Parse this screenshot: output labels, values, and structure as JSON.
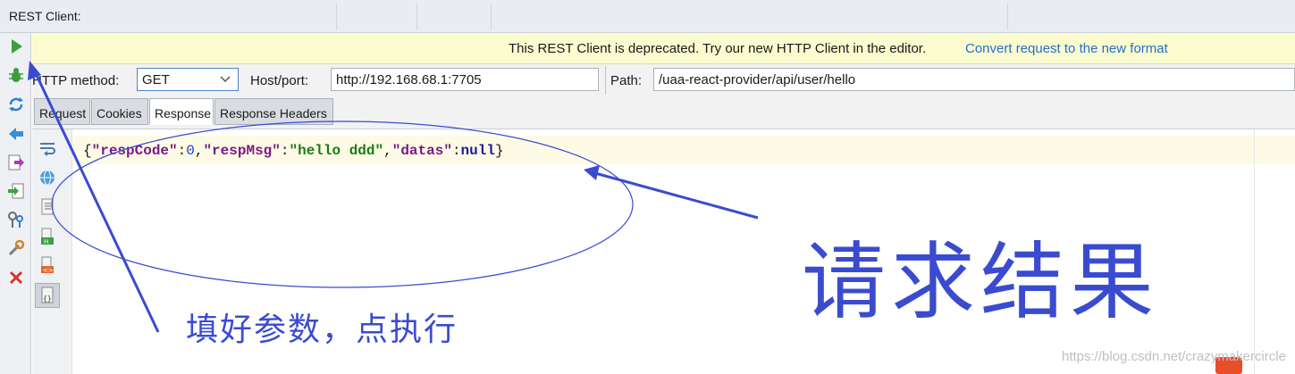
{
  "window": {
    "title": "REST Client:"
  },
  "banner": {
    "message": "This REST Client is deprecated. Try our new HTTP Client in the editor.",
    "link": "Convert request to the new format"
  },
  "request": {
    "method_label": "HTTP method:",
    "method_value": "GET",
    "host_label": "Host/port:",
    "host_value": "http://192.168.68.1:7705",
    "path_label": "Path:",
    "path_value": "/uaa-react-provider/api/user/hello"
  },
  "tabs": [
    {
      "label": "Request"
    },
    {
      "label": "Cookies"
    },
    {
      "label": "Response"
    },
    {
      "label": "Response Headers"
    }
  ],
  "active_tab": "Response",
  "response": {
    "open": "{",
    "k1": "\"respCode\"",
    "colon": ":",
    "v1": "0",
    "comma": ",",
    "k2": "\"respMsg\"",
    "v2": "\"hello ddd\"",
    "k3": "\"datas\"",
    "v3": "null",
    "close": "}"
  },
  "annotations": {
    "fill_params": "填好参数，点执行",
    "result": "请求结果",
    "color": "#3a4bd0"
  },
  "toolbar_icons": [
    "run-icon",
    "debug-icon",
    "refresh-icon",
    "back-icon",
    "export-icon",
    "import-icon",
    "keys-icon",
    "settings-icon",
    "close-icon"
  ],
  "watermark": "https://blog.csdn.net/crazymakercircle"
}
